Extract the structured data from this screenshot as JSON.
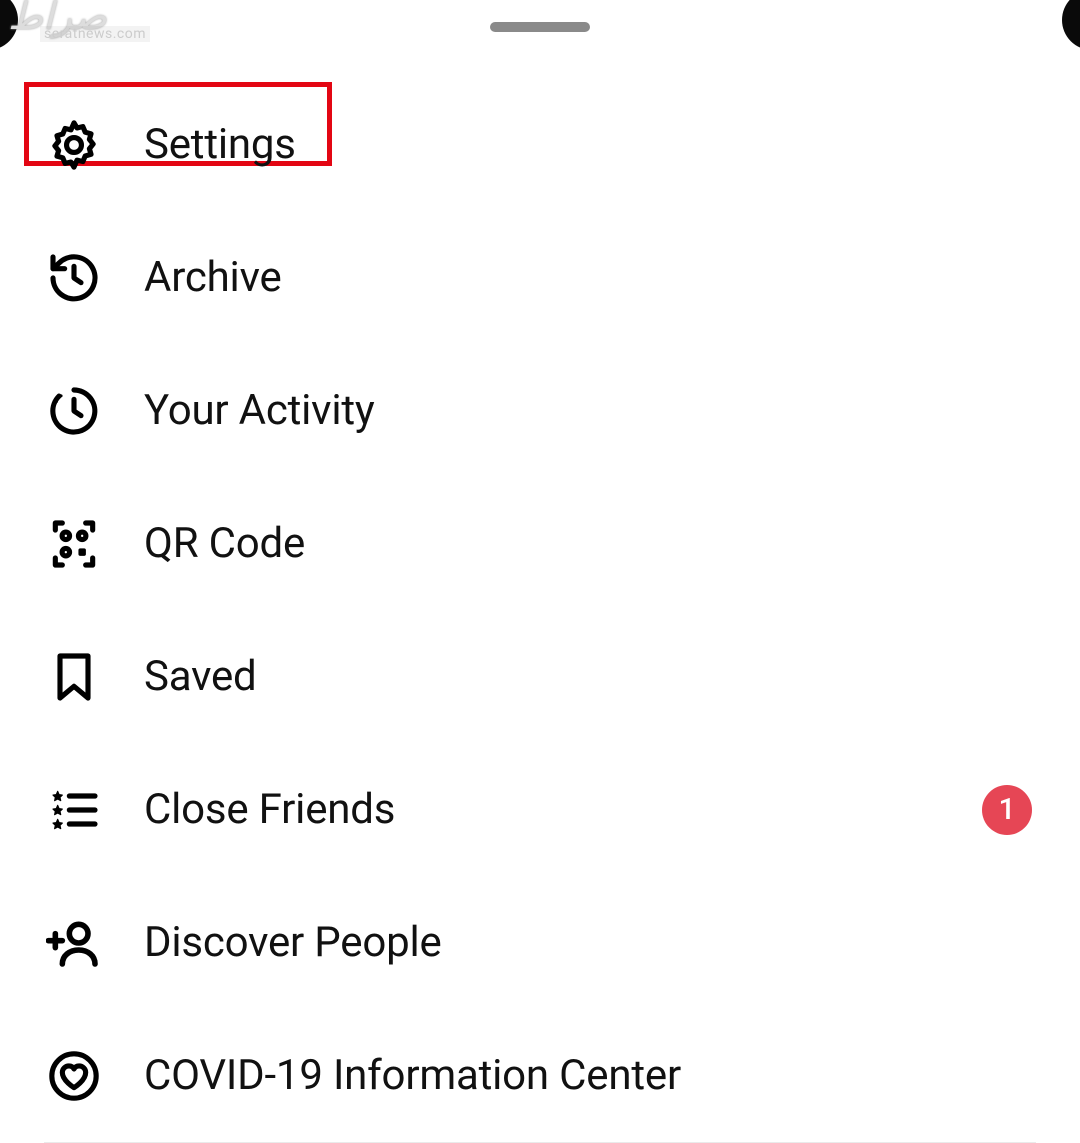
{
  "watermark": {
    "logo": "صراط",
    "text": "seratnews.com"
  },
  "highlight_color": "#e30613",
  "badge_color": "#e64655",
  "menu": {
    "items": [
      {
        "id": "settings",
        "label": "Settings",
        "icon": "gear-icon",
        "highlighted": true
      },
      {
        "id": "archive",
        "label": "Archive",
        "icon": "history-icon"
      },
      {
        "id": "activity",
        "label": "Your Activity",
        "icon": "clock-dotted-icon"
      },
      {
        "id": "qrcode",
        "label": "QR Code",
        "icon": "qr-code-icon"
      },
      {
        "id": "saved",
        "label": "Saved",
        "icon": "bookmark-icon"
      },
      {
        "id": "close-friends",
        "label": "Close Friends",
        "icon": "star-list-icon",
        "badge": "1"
      },
      {
        "id": "discover",
        "label": "Discover People",
        "icon": "add-person-icon"
      },
      {
        "id": "covid",
        "label": "COVID-19 Information Center",
        "icon": "heart-circle-icon"
      }
    ]
  }
}
